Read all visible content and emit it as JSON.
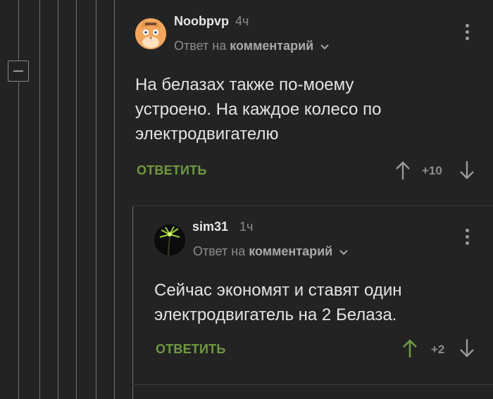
{
  "comment": {
    "username": "Noobpvp",
    "time": "4ч",
    "reply_prefix": "Ответ на",
    "reply_target": "комментарий",
    "text_lines": [
      "На белазах также по-моему",
      "устроено. На каждое колесо по",
      "электродвигателю"
    ],
    "reply_label": "ОТВЕТИТЬ",
    "score": "+10"
  },
  "reply": {
    "username": "sim31",
    "time": "1ч",
    "reply_prefix": "Ответ на",
    "reply_target": "комментарий",
    "text_lines": [
      "Сейчас экономят и ставят один",
      "электродвигатель на 2 Белаза."
    ],
    "reply_label": "ОТВЕТИТЬ",
    "score": "+2"
  },
  "colors": {
    "background": "#232323",
    "accent_green": "#6e9a40",
    "muted": "#8c8c8c"
  },
  "icons": {
    "collapse": "minus-square-icon",
    "kebab": "vertical-dots-icon",
    "upvote": "arrow-up-icon",
    "downvote": "arrow-down-icon",
    "chevron": "chevron-down-icon"
  }
}
